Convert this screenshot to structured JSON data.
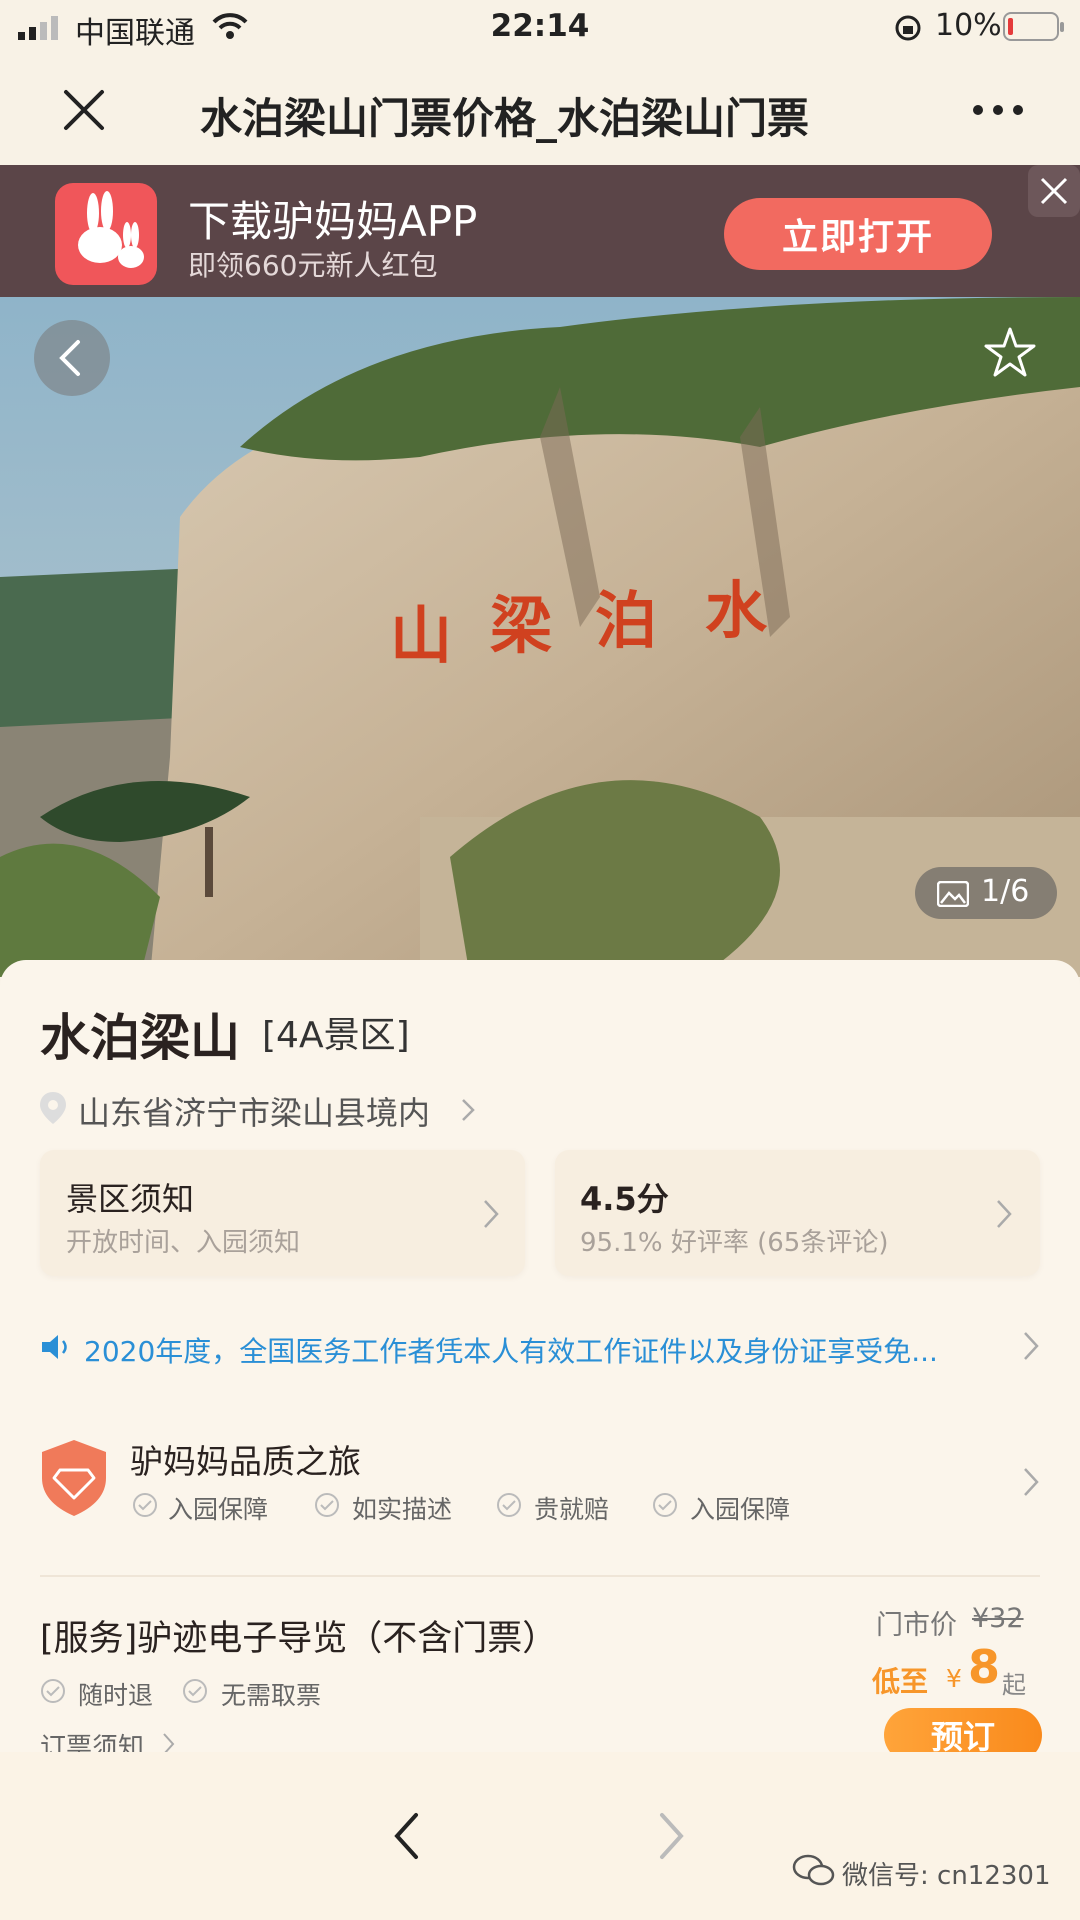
{
  "status_bar": {
    "carrier": "中国联通",
    "time": "22:14",
    "battery": "10%"
  },
  "nav": {
    "title": "水泊梁山门票价格_水泊梁山门票"
  },
  "app_banner": {
    "title": "下载驴妈妈APP",
    "subtitle": "即领660元新人红包",
    "button": "立即打开"
  },
  "hero": {
    "counter": "1/6",
    "inscription": "水泊梁山"
  },
  "spot": {
    "name": "水泊梁山",
    "level": "[4A景区]",
    "address": "山东省济宁市梁山县境内"
  },
  "tiles": {
    "notice_title": "景区须知",
    "notice_sub": "开放时间、入园须知",
    "rating_score": "4.5分",
    "rating_sub": "95.1% 好评率 (65条评论)"
  },
  "announcement": "2020年度，全国医务工作者凭本人有效工作证件以及身份证享受免...",
  "quality": {
    "title": "驴妈妈品质之旅",
    "items": [
      "入园保障",
      "如实描述",
      "贵就赔",
      "入园保障"
    ]
  },
  "product": {
    "title": "[服务]驴迹电子导览（不含门票）",
    "tags": [
      "随时退",
      "无需取票"
    ],
    "booking_notice": "订票须知",
    "market_price_label": "门市价",
    "market_price": "¥32",
    "low_label": "低至",
    "currency": "¥",
    "price": "8",
    "price_suffix": "起",
    "book_button": "预订"
  },
  "watermark": "微信号: cn12301",
  "colors": {
    "accent_orange": "#f7962a",
    "banner_bg": "#5b4548",
    "link_blue": "#2a8fd6",
    "page_bg": "#f8f2e6"
  }
}
